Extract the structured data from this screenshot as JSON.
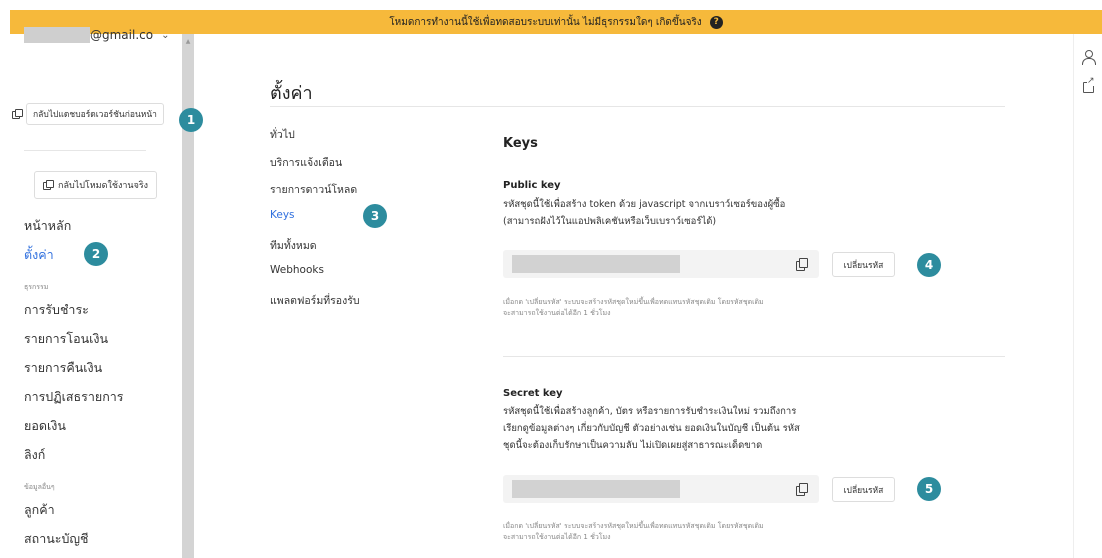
{
  "banner": {
    "text": "โหมดการทำงานนี้ใช้เพื่อทดสอบระบบเท่านั้น ไม่มีธุรกรรมใดๆ เกิดขึ้นจริง",
    "icon": "help-icon"
  },
  "account": {
    "email_suffix": "@gmail.co",
    "icon": "chevron-down-icon"
  },
  "sidebar": {
    "old_dashboard_label": "กลับไปแดชบอร์ดเวอร์ชันก่อนหน้า",
    "live_mode_label": "กลับไปโหมดใช้งานจริง",
    "home": "หน้าหลัก",
    "settings": "ตั้งค่า",
    "transactions_heading": "ธุรกรรม",
    "items": [
      "การรับชำระ",
      "รายการโอนเงิน",
      "รายการคืนเงิน",
      "การปฏิเสธรายการ",
      "ยอดเงิน",
      "ลิงก์"
    ],
    "info_heading": "ข้อมูลอื่นๆ",
    "info_items": [
      "ลูกค้า",
      "สถานะบัญชี"
    ]
  },
  "badges": [
    "1",
    "2",
    "3",
    "4",
    "5"
  ],
  "main": {
    "title": "ตั้งค่า",
    "subnav": [
      "ทั่วไป",
      "บริการแจ้งเตือน",
      "รายการดาวน์โหลด",
      "Keys",
      "ทีมทั้งหมด",
      "Webhooks",
      "แพลตฟอร์มที่รองรับ"
    ],
    "active_subnav": "Keys",
    "section_title": "Keys",
    "public_key": {
      "title": "Public key",
      "desc_lines": [
        "รหัสชุดนี้ใช้เพื่อสร้าง token ด้วย javascript จากเบราว์เซอร์ของผู้ซื้อ",
        "(สามารถฝังไว้ในแอปพลิเคชันหรือเว็บเบราว์เซอร์ได้)"
      ],
      "change_label": "เปลี่ยนรหัส",
      "note_lines": [
        "เมื่อกด 'เปลี่ยนรหัส' ระบบจะสร้างรหัสชุดใหม่ขึ้นเพื่อทดแทนรหัสชุดเดิม โดยรหัสชุดเดิม",
        "จะสามารถใช้งานต่อได้อีก 1 ชั่วโมง"
      ]
    },
    "secret_key": {
      "title": "Secret key",
      "desc_lines": [
        "รหัสชุดนี้ใช้เพื่อสร้างลูกค้า, บัตร หรือรายการรับชำระเงินใหม่ รวมถึงการ",
        "เรียกดูข้อมูลต่างๆ เกี่ยวกับบัญชี ตัวอย่างเช่น ยอดเงินในบัญชี เป็นต้น รหัส",
        "ชุดนี้จะต้องเก็บรักษาเป็นความลับ ไม่เปิดเผยสู่สาธารณะเด็ดขาด"
      ],
      "change_label": "เปลี่ยนรหัส",
      "note_lines": [
        "เมื่อกด 'เปลี่ยนรหัส' ระบบจะสร้างรหัสชุดใหม่ขึ้นเพื่อทดแทนรหัสชุดเดิม โดยรหัสชุดเดิม",
        "จะสามารถใช้งานต่อได้อีก 1 ชั่วโมง"
      ]
    }
  },
  "right_bar": {
    "icons": [
      "user-icon",
      "external-link-icon"
    ]
  },
  "colors": {
    "banner": "#f6b93b",
    "accent": "#2f6fde",
    "badge": "#2d8c9e"
  }
}
